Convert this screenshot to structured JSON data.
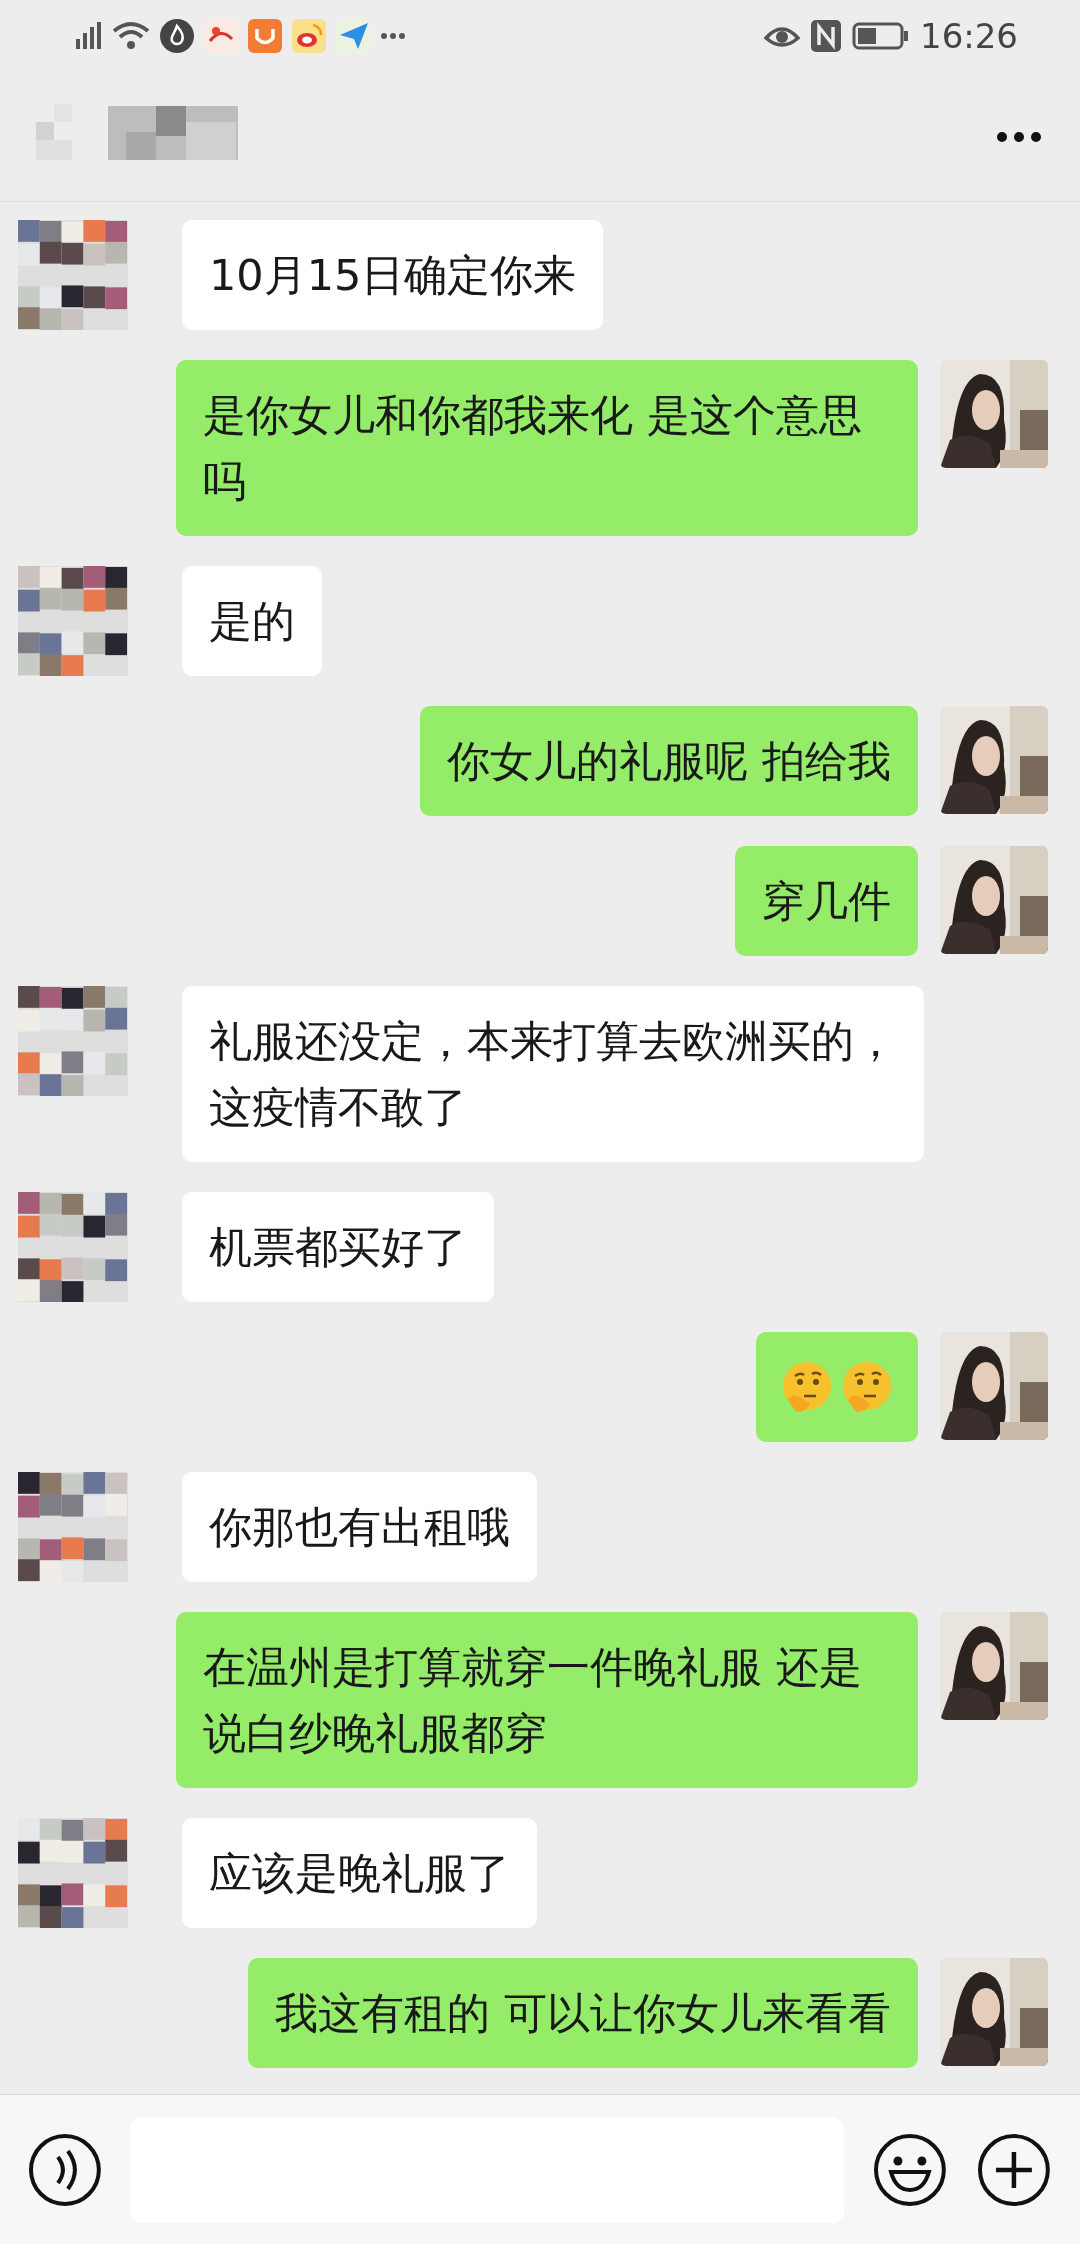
{
  "status_bar": {
    "time": "16:26"
  },
  "messages": [
    {
      "outgoing": false,
      "kind": "text",
      "text": "10月15日确定你来"
    },
    {
      "outgoing": true,
      "kind": "text",
      "text": "是你女儿和你都我来化 是这个意思吗"
    },
    {
      "outgoing": false,
      "kind": "text",
      "text": "是的"
    },
    {
      "outgoing": true,
      "kind": "text",
      "text": "你女儿的礼服呢 拍给我"
    },
    {
      "outgoing": true,
      "kind": "text",
      "text": "穿几件"
    },
    {
      "outgoing": false,
      "kind": "text",
      "text": "礼服还没定，本来打算去欧洲买的，这疫情不敢了"
    },
    {
      "outgoing": false,
      "kind": "text",
      "text": "机票都买好了"
    },
    {
      "outgoing": true,
      "kind": "stickers"
    },
    {
      "outgoing": false,
      "kind": "text",
      "text": "你那也有出租哦"
    },
    {
      "outgoing": true,
      "kind": "text",
      "text": "在温州是打算就穿一件晚礼服 还是说白纱晚礼服都穿"
    },
    {
      "outgoing": false,
      "kind": "text",
      "text": "应该是晚礼服了"
    },
    {
      "outgoing": true,
      "kind": "text",
      "text": "我这有租的 可以让你女儿来看看"
    }
  ]
}
